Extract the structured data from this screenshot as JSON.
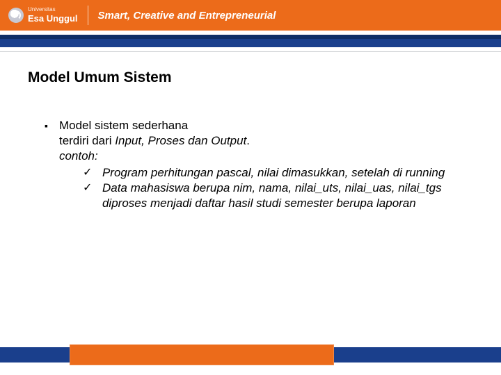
{
  "header": {
    "brand_top": "Universitas",
    "brand_main": "Esa Unggul",
    "tagline": "Smart, Creative and Entrepreneurial"
  },
  "slide": {
    "title": "Model Umum Sistem",
    "bullet": {
      "line1": "Model sistem sederhana",
      "line2_prefix": "terdiri dari ",
      "line2_em": "Input, Proses dan Output",
      "line2_suffix": ".",
      "line3": "contoh:",
      "checks": [
        "Program perhitungan pascal, nilai dimasukkan, setelah di running",
        "Data mahasiswa berupa nim, nama, nilai_uts, nilai_uas, nilai_tgs diproses menjadi daftar hasil studi semester berupa laporan"
      ]
    }
  }
}
